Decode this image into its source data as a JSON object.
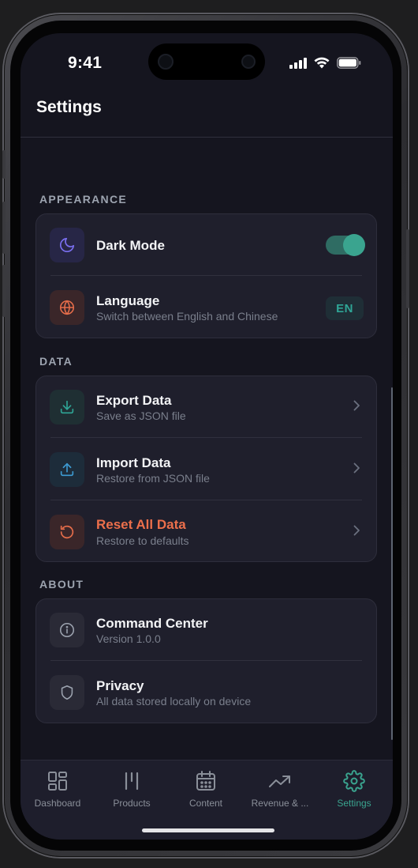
{
  "status_bar": {
    "time": "9:41"
  },
  "header": {
    "title": "Settings"
  },
  "sections": {
    "appearance": {
      "label": "APPEARANCE",
      "dark_mode": {
        "title": "Dark Mode",
        "enabled": true
      },
      "language": {
        "title": "Language",
        "subtitle": "Switch between English and Chinese",
        "value": "EN"
      }
    },
    "data": {
      "label": "DATA",
      "export": {
        "title": "Export Data",
        "subtitle": "Save as JSON file"
      },
      "import": {
        "title": "Import Data",
        "subtitle": "Restore from JSON file"
      },
      "reset": {
        "title": "Reset All Data",
        "subtitle": "Restore to defaults"
      }
    },
    "about": {
      "label": "ABOUT",
      "app": {
        "title": "Command Center",
        "subtitle": "Version 1.0.0"
      },
      "privacy": {
        "title": "Privacy",
        "subtitle": "All data stored locally on device"
      }
    }
  },
  "tabs": [
    {
      "label": "Dashboard",
      "icon": "grid-icon",
      "active": false
    },
    {
      "label": "Products",
      "icon": "bars-icon",
      "active": false
    },
    {
      "label": "Content",
      "icon": "calendar-icon",
      "active": false
    },
    {
      "label": "Revenue & ...",
      "icon": "trending-up-icon",
      "active": false
    },
    {
      "label": "Settings",
      "icon": "gear-icon",
      "active": true
    }
  ],
  "colors": {
    "accent": "#3aa48f",
    "danger": "#ec6f4b",
    "background": "#15151f",
    "card": "#1f1f2c"
  }
}
